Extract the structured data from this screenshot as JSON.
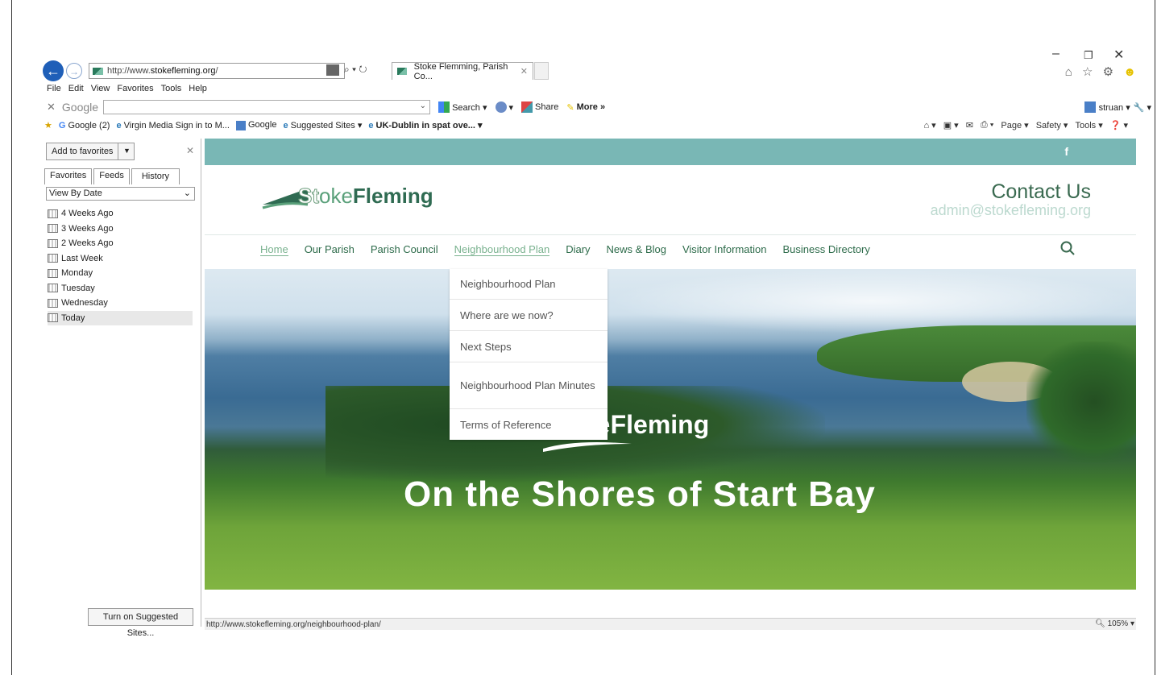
{
  "window": {
    "minimize": "–",
    "restore": "❐",
    "close": "✕"
  },
  "browser": {
    "address": {
      "prefix": "http://www.",
      "domain": "stokefleming.org",
      "suffix": "/"
    },
    "search_glyph": "⌕ ▾ ↻",
    "tab": {
      "title": "Stoke Flemming, Parish Co...",
      "close": "✕"
    },
    "right_icons": "⌂ ☆ ⚙",
    "smiley": "☻"
  },
  "menubar": [
    "File",
    "Edit",
    "View",
    "Favorites",
    "Tools",
    "Help"
  ],
  "google_toolbar": {
    "close": "✕",
    "logo": "Google",
    "search_value": "",
    "items": [
      "Search ▾",
      "▾",
      "Share",
      "More »"
    ],
    "user": "struan ▾",
    "wrench": "🔧 ▾"
  },
  "favorites_bar": {
    "items": [
      "Google (2)",
      "Virgin Media Sign in to M...",
      "Google",
      "Suggested Sites ▾",
      "UK-Dublin in spat ove... ▾"
    ]
  },
  "command_bar": [
    "⌂ ▾",
    "▣ ▾",
    "✉",
    "⎙ ▾",
    "Page ▾",
    "Safety ▾",
    "Tools ▾",
    "❓ ▾"
  ],
  "favorites_pane": {
    "add_button": "Add to favorites",
    "add_dropdown": "▼",
    "close": "✕",
    "tabs": [
      "Favorites",
      "Feeds",
      "History"
    ],
    "view_by": "View By Date",
    "history": [
      "4 Weeks Ago",
      "3 Weeks Ago",
      "2 Weeks Ago",
      "Last Week",
      "Monday",
      "Tuesday",
      "Wednesday",
      "Today"
    ],
    "suggested_button": "Turn on Suggested Sites..."
  },
  "site": {
    "facebook": "f",
    "logo": {
      "st": "St",
      "oke": "oke",
      "fleming": "Fleming"
    },
    "contact_heading": "Contact Us",
    "contact_email": "admin@stokefleming.org",
    "nav": [
      "Home",
      "Our Parish",
      "Parish Council",
      "Neighbourhood Plan",
      "Diary",
      "News & Blog",
      "Visitor Information",
      "Business Directory"
    ],
    "dropdown": [
      "Neighbourhood Plan",
      "Where are we now?",
      "Next Steps",
      "Neighbourhood Plan Minutes",
      "Terms of Reference"
    ],
    "hero_title": "On the Shores of Start Bay"
  },
  "status": {
    "url": "http://www.stokefleming.org/neighbourhood-plan/",
    "zoom": "105%"
  }
}
